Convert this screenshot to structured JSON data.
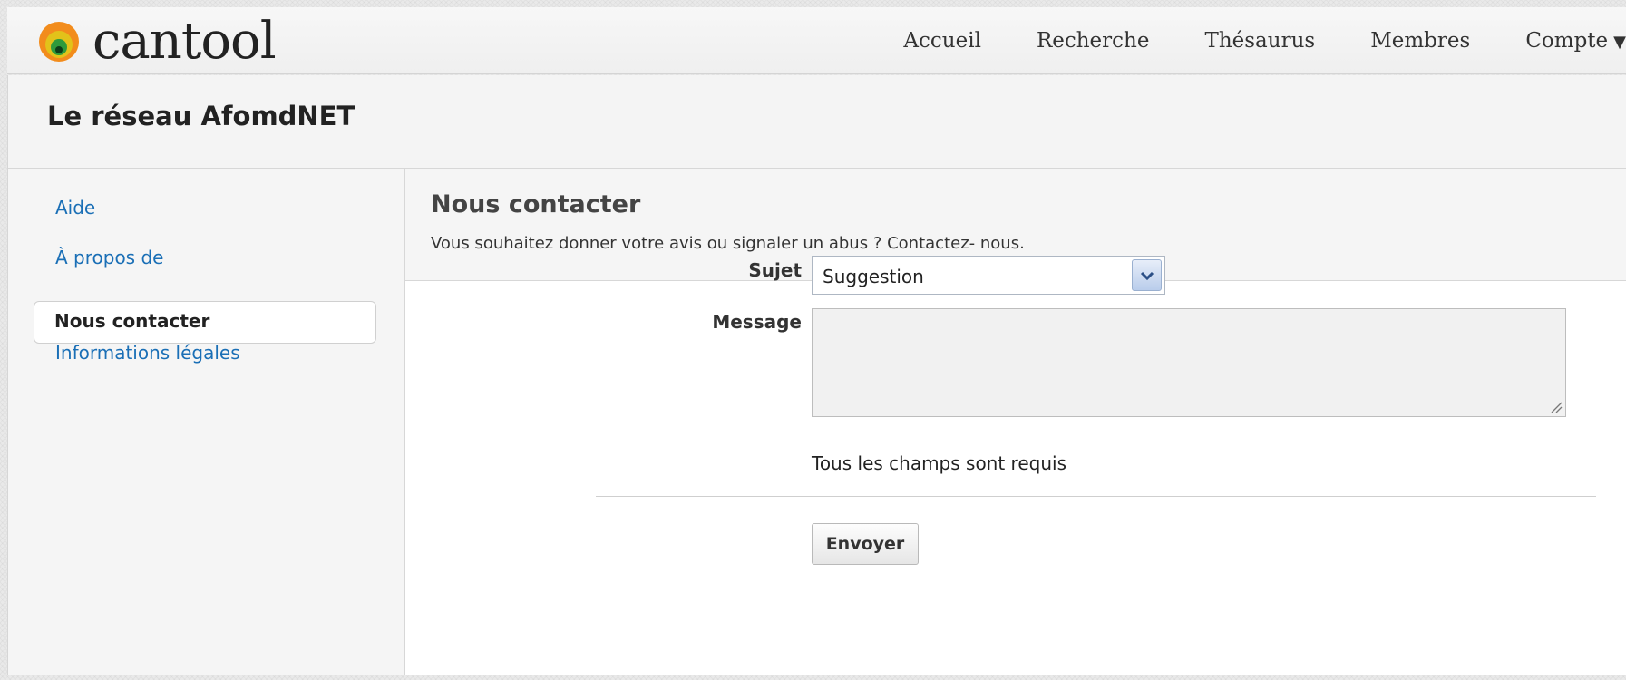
{
  "app": {
    "logo_text": "cantool"
  },
  "nav": {
    "items": [
      {
        "label": "Accueil"
      },
      {
        "label": "Recherche"
      },
      {
        "label": "Thésaurus"
      },
      {
        "label": "Membres"
      },
      {
        "label": "Compte"
      }
    ],
    "account_caret": "▼"
  },
  "network": {
    "title": "Le réseau AfomdNET"
  },
  "sidebar": {
    "items": [
      {
        "label": "Aide",
        "active": false
      },
      {
        "label": "À propos de",
        "active": false
      },
      {
        "label": "Nous contacter",
        "active": true
      },
      {
        "label": "Informations légales",
        "active": false
      }
    ]
  },
  "content": {
    "title": "Nous contacter",
    "description": "Vous souhaitez donner votre avis ou signaler un abus ? Contactez- nous."
  },
  "form": {
    "subject_label": "Sujet",
    "subject_value": "Suggestion",
    "message_label": "Message",
    "message_value": "",
    "required_note": "Tous les champs sont requis",
    "submit_label": "Envoyer"
  },
  "colors": {
    "link": "#1a6fb6",
    "logo_outer": "#f28c1c",
    "logo_ring": "#e2c21a",
    "logo_inner": "#2e9a3c"
  },
  "icons": {
    "logo": "cantool-logo-icon",
    "select_arrow": "chevron-down-icon",
    "resize": "resize-grip-icon"
  }
}
